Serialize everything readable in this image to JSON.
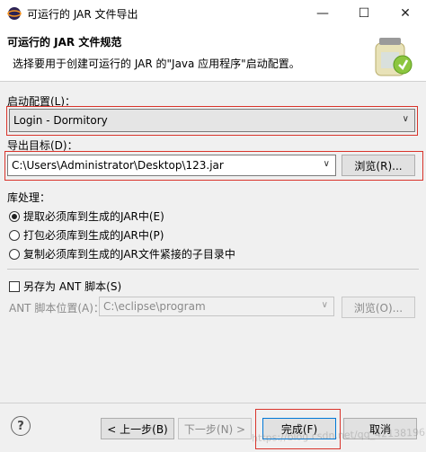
{
  "window": {
    "title": "可运行的 JAR 文件导出",
    "min_icon": "minimize-icon",
    "max_icon": "maximize-icon",
    "close_icon": "close-icon"
  },
  "header": {
    "title": "可运行的 JAR 文件规范",
    "description": "选择要用于创建可运行的 JAR 的\"Java 应用程序\"启动配置。"
  },
  "launch": {
    "label": "启动配置(L)：",
    "value": "Login - Dormitory"
  },
  "export": {
    "label": "导出目标(D)：",
    "value": "C:\\Users\\Administrator\\Desktop\\123.jar",
    "browse": "浏览(R)..."
  },
  "library": {
    "label": "库处理：",
    "options": [
      {
        "label": "提取必须库到生成的JAR中(E)",
        "selected": true
      },
      {
        "label": "打包必须库到生成的JAR中(P)",
        "selected": false
      },
      {
        "label": "复制必须库到生成的JAR文件紧接的子目录中",
        "selected": false
      }
    ]
  },
  "ant": {
    "checkbox_label": "另存为 ANT 脚本(S)",
    "checked": false,
    "location_label": "ANT 脚本位置(A)：",
    "location_value": "C:\\eclipse\\program",
    "browse": "浏览(O)..."
  },
  "buttons": {
    "help": "?",
    "back": "< 上一步(B)",
    "next": "下一步(N) >",
    "finish": "完成(F)",
    "cancel": "取消"
  },
  "watermark": "https://blog.csdn.net/qq_42138196",
  "colors": {
    "highlight_red": "#d9342b",
    "focus_blue": "#0078d7"
  }
}
